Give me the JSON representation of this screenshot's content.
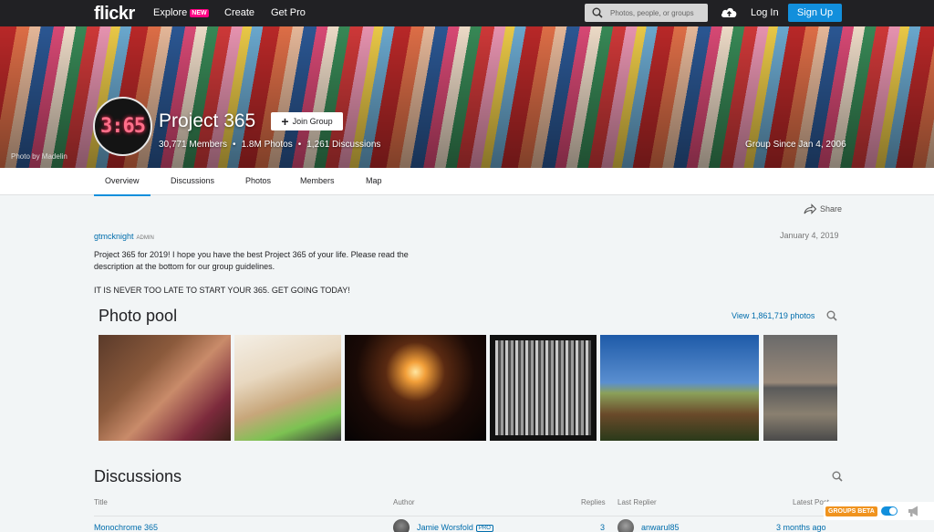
{
  "nav": {
    "logo": "flickr",
    "explore": "Explore",
    "explore_badge": "NEW",
    "create": "Create",
    "get_pro": "Get Pro",
    "search_placeholder": "Photos, people, or groups",
    "login": "Log In",
    "signup": "Sign Up"
  },
  "hero": {
    "avatar_text": "3:65",
    "title": "Project 365",
    "join_button": "Join Group",
    "members": "30,771 Members",
    "photos": "1.8M Photos",
    "discussions": "1,261 Discussions",
    "separator": "•",
    "photo_credit": "Photo by Madelin",
    "group_since": "Group Since Jan 4, 2006"
  },
  "tabs": [
    {
      "label": "Overview",
      "active": true
    },
    {
      "label": "Discussions",
      "active": false
    },
    {
      "label": "Photos",
      "active": false
    },
    {
      "label": "Members",
      "active": false
    },
    {
      "label": "Map",
      "active": false
    }
  ],
  "share": "Share",
  "post": {
    "author": "gtmcknight",
    "role": "ADMIN",
    "date": "January 4, 2019",
    "paragraph1": "Project 365 for 2019! I hope you have the best Project 365 of your life. Please read the description at the bottom for our group guidelines.",
    "paragraph2": "IT IS NEVER TOO LATE TO START YOUR 365. GET GOING TODAY!"
  },
  "photo_pool": {
    "title": "Photo pool",
    "view_link": "View 1,861,719 photos"
  },
  "discussions": {
    "title": "Discussions",
    "columns": {
      "title": "Title",
      "author": "Author",
      "replies": "Replies",
      "last_replier": "Last Replier",
      "latest_post": "Latest Post"
    },
    "rows": [
      {
        "title": "Monochrome 365",
        "author": "Jamie Worsfold",
        "author_badge": "PRO",
        "replies": "3",
        "last_replier": "anwarul85",
        "latest_post": "3 months ago"
      }
    ]
  },
  "beta": {
    "label": "GROUPS BETA"
  },
  "colors": {
    "accent": "#128fdc",
    "link": "#006dac",
    "explore_badge": "#ff0084",
    "beta_badge": "#f0931e"
  }
}
